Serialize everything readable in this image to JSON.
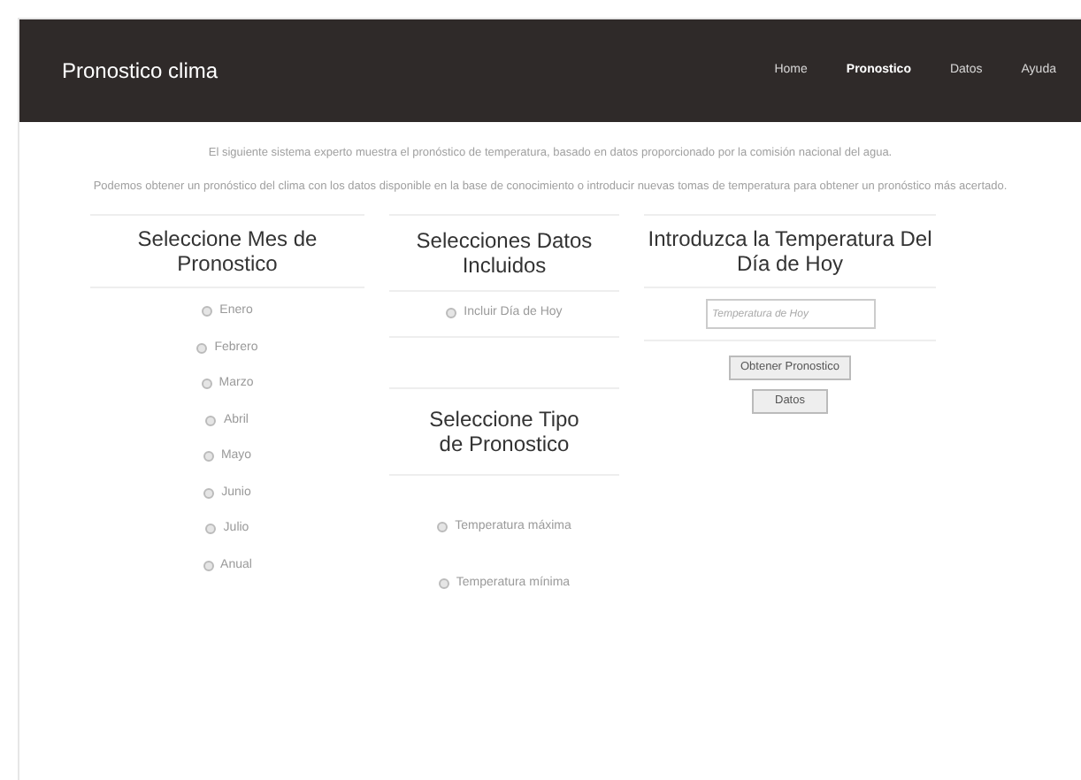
{
  "header": {
    "title": "Pronostico clima",
    "nav": [
      {
        "label": "Home",
        "selected": false
      },
      {
        "label": "Pronostico",
        "selected": true
      },
      {
        "label": "Datos",
        "selected": false
      },
      {
        "label": "Ayuda",
        "selected": false
      }
    ]
  },
  "intro": [
    "El siguiente sistema experto muestra el pronóstico de temperatura, basado en datos proporcionado por la comisión nacional del agua.",
    "Podemos obtener un pronóstico del clima con los datos disponible en la base de conocimiento o introducir nuevas tomas de temperatura para obtener un pronóstico más acertado."
  ],
  "months": {
    "title": "Seleccione Mes de Pronostico",
    "options": [
      {
        "label": "Enero",
        "selected": false
      },
      {
        "label": "Febrero",
        "selected": false
      },
      {
        "label": "Marzo",
        "selected": false
      },
      {
        "label": "Abril",
        "selected": false
      },
      {
        "label": "Mayo",
        "selected": false
      },
      {
        "label": "Junio",
        "selected": false
      },
      {
        "label": "Julio",
        "selected": false
      },
      {
        "label": "Anual",
        "selected": false
      }
    ]
  },
  "data_included": {
    "title": "Selecciones Datos Incluidos",
    "options": [
      {
        "label": "Incluir Día de Hoy",
        "selected": false
      }
    ]
  },
  "forecast_type": {
    "title": "Seleccione Tipo de Pronostico",
    "options": [
      {
        "label": "Temperatura máxima",
        "selected": false
      },
      {
        "label": "Temperatura mínima",
        "selected": false
      }
    ]
  },
  "temperature": {
    "title": "Introduzca la Temperatura Del Día de Hoy",
    "placeholder": "Temperatura de Hoy",
    "buttons": [
      "Obtener Pronostico",
      "Datos"
    ]
  }
}
